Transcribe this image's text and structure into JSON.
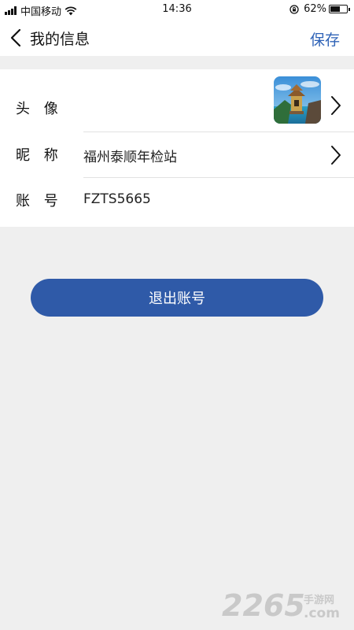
{
  "status_bar": {
    "carrier": "中国移动",
    "time": "14:36",
    "battery_percent_text": "62%",
    "battery_level": 0.62
  },
  "nav": {
    "title": "我的信息",
    "save_label": "保存",
    "back_icon": "chevron-left-icon"
  },
  "profile": {
    "avatar_label": "头 像",
    "nickname_label": "昵 称",
    "nickname_value": "福州泰顺年检站",
    "account_label": "账 号",
    "account_value": "FZTS5665"
  },
  "logout_label": "退出账号",
  "watermark": {
    "number": "2265",
    "text": "手游网",
    "domain": ".com"
  },
  "colors": {
    "accent": "#2f5aa8",
    "save_text": "#2f63b7",
    "background": "#efefef"
  }
}
